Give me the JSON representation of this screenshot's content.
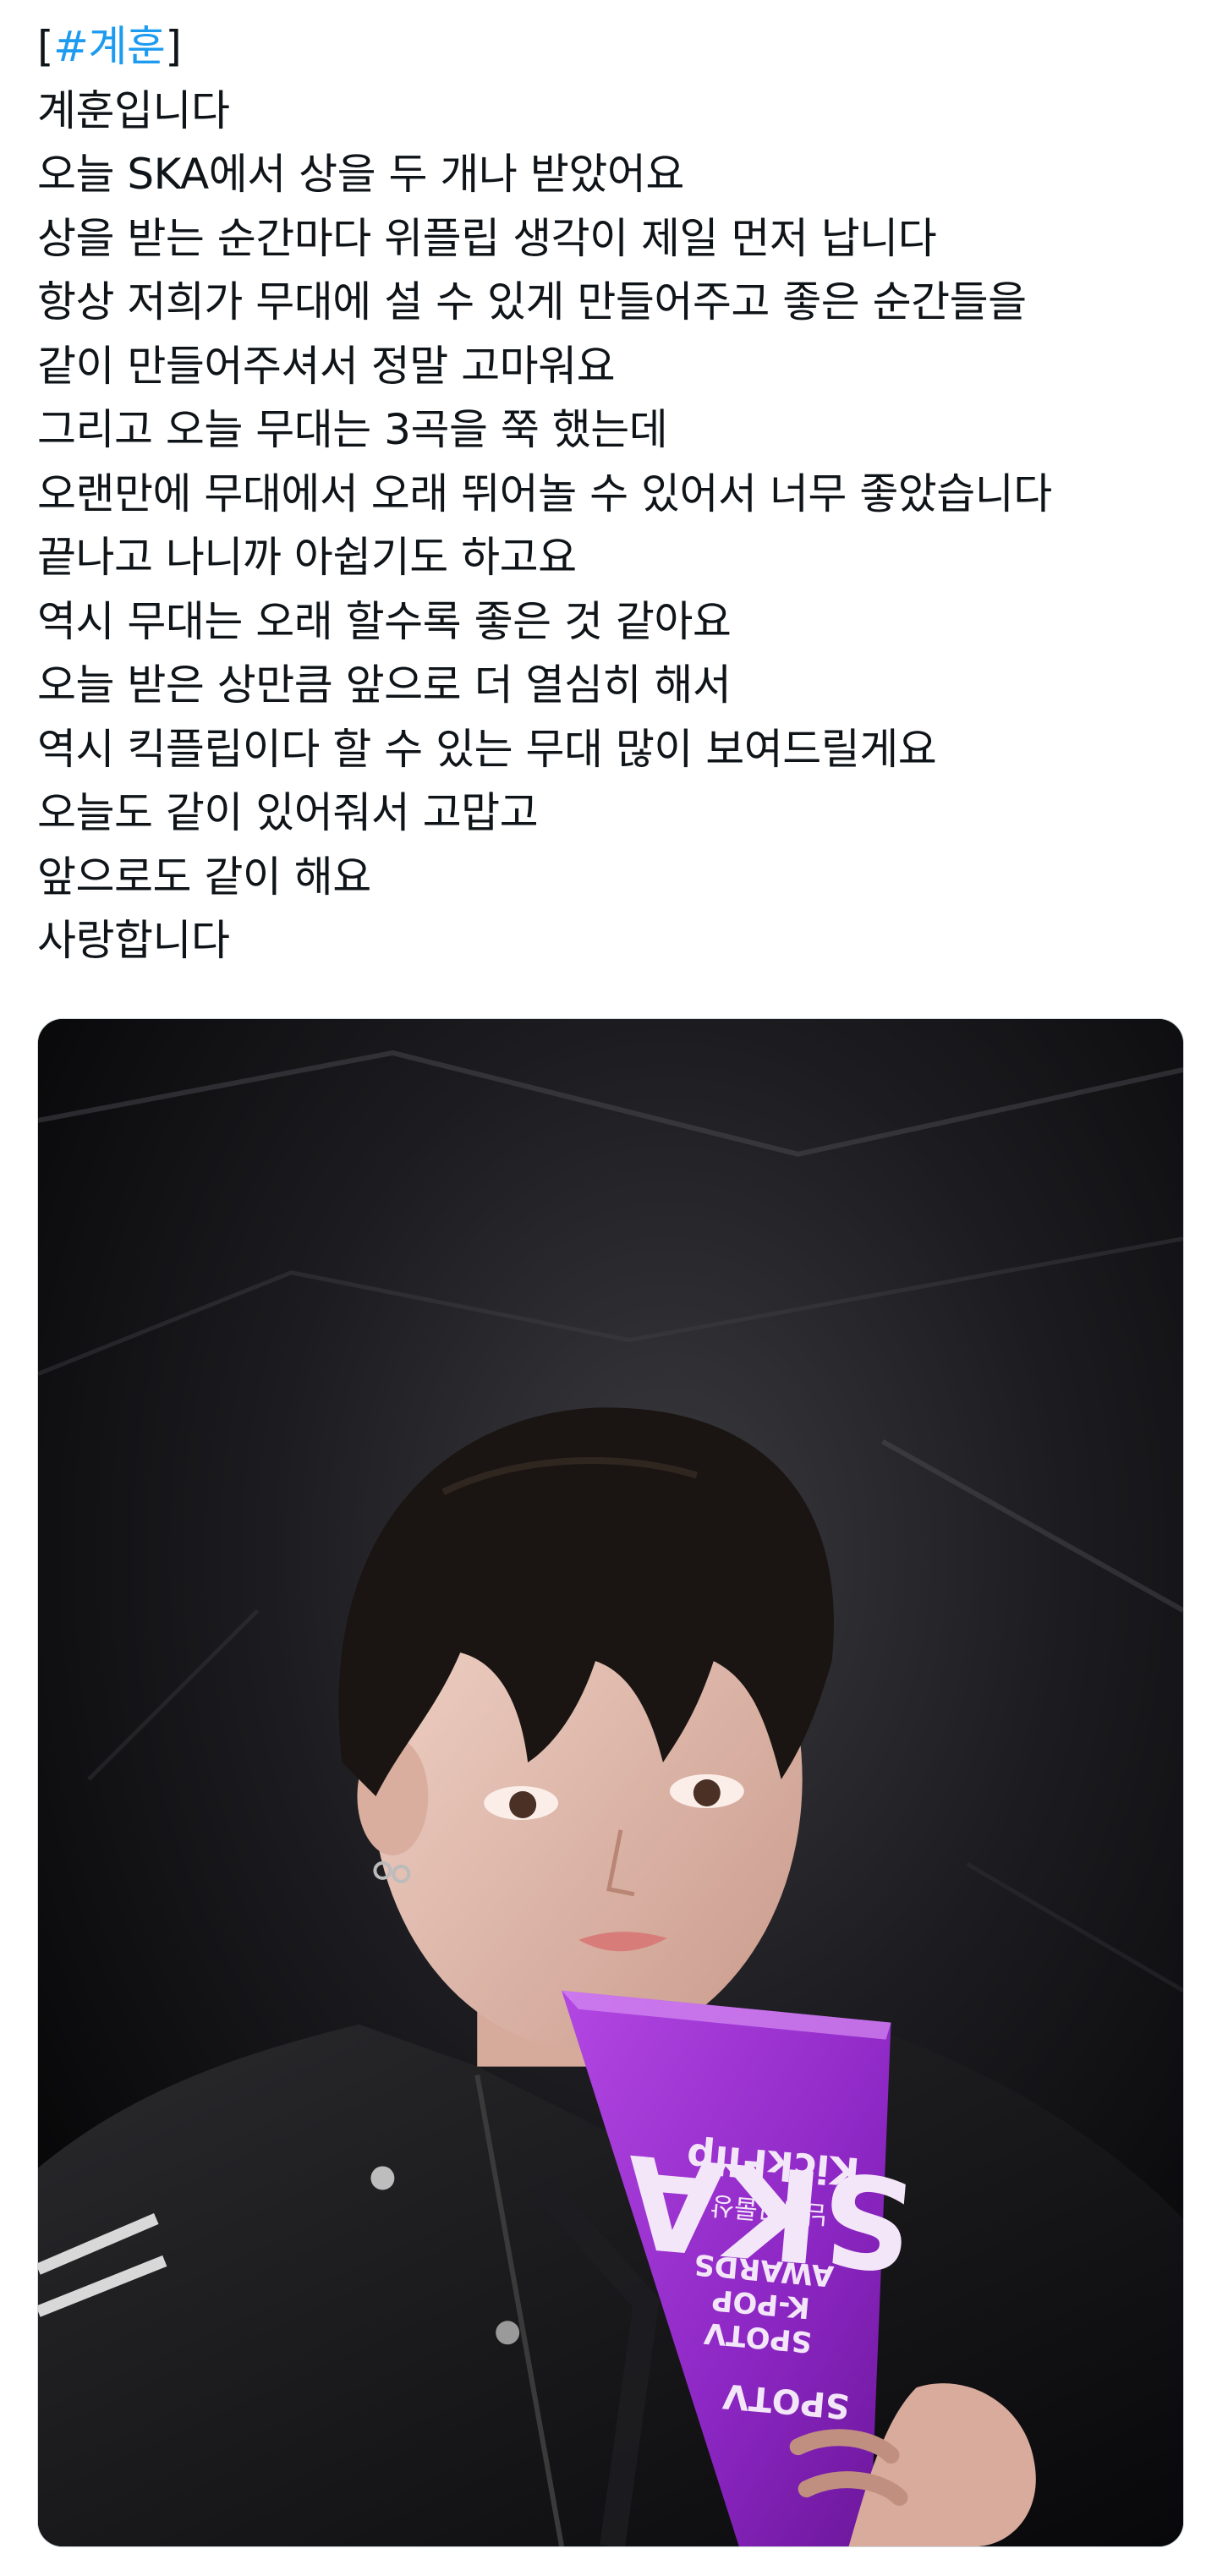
{
  "tweet": {
    "hashtag_open": "[",
    "hashtag": "#계훈",
    "hashtag_close": "]",
    "lines": [
      "계훈입니다",
      "오늘 SKA에서 상을 두 개나 받았어요",
      "상을 받는 순간마다 위플립 생각이 제일 먼저 납니다",
      "항상 저희가 무대에 설 수 있게 만들어주고 좋은 순간들을",
      "같이 만들어주셔서 정말 고마워요",
      "그리고 오늘 무대는 3곡을 쭉 했는데",
      "오랜만에 무대에서 오래 뛰어놀 수 있어서 너무 좋았습니다",
      "끝나고 나니까 아쉽기도 하고요",
      "역시 무대는 오래 할수록 좋은 것 같아요",
      "오늘 받은 상만큼 앞으로 더 열심히 해서",
      "역시 킥플립이다 할 수 있는 무대 많이 보여드릴게요",
      "오늘도 같이 있어줘서 고맙고",
      "앞으로도 같이 해요",
      "사랑합니다"
    ]
  },
  "photo": {
    "trophy": {
      "logo": "SKA",
      "line1": "SPOTV",
      "line2": "K-POP",
      "line3": "AWARDS",
      "award": "남자그룹상",
      "artist": "KickFlip",
      "footer": "SPOTV"
    },
    "colors": {
      "trophy": "#9b2fd0",
      "background": "#0e0e10",
      "skin": "#e8c3b6",
      "hair": "#1a1512",
      "jacket": "#101010"
    }
  }
}
